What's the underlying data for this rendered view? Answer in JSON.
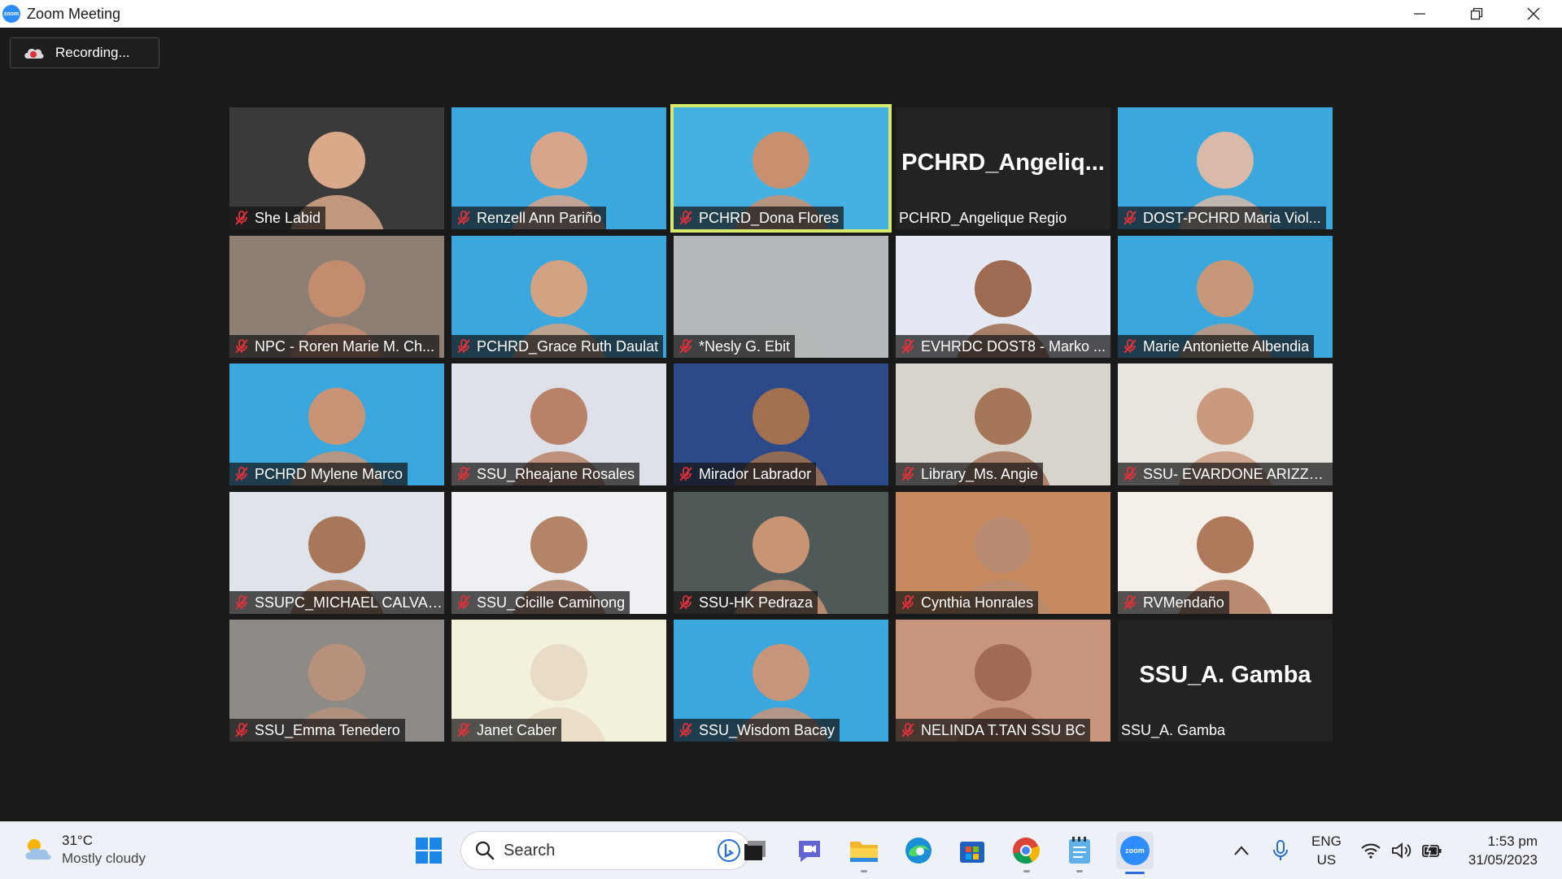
{
  "window": {
    "title": "Zoom Meeting",
    "logo_text": "zoom"
  },
  "recording": {
    "label": "Recording..."
  },
  "participants": [
    {
      "name": "She Labid",
      "bg": "#3a3a3a",
      "skin": "#d9a98a"
    },
    {
      "name": "Renzell Ann Pariño",
      "bg": "#3aa7de",
      "skin": "#d8a58a"
    },
    {
      "name": "PCHRD_Dona Flores",
      "bg": "#45b1e2",
      "skin": "#c9906f",
      "active": true
    },
    {
      "name": "PCHRD_Angelique Regio",
      "big": "PCHRD_Angeliq...",
      "no_video": true
    },
    {
      "name": "DOST-PCHRD Maria Viol...",
      "bg": "#3aa7de",
      "skin": "#d9b9a8"
    },
    {
      "name": "NPC - Roren Marie M. Ch...",
      "bg": "#8d7f74",
      "skin": "#c48c6e"
    },
    {
      "name": "PCHRD_Grace Ruth Daulat",
      "bg": "#3aa7de",
      "skin": "#d3a282"
    },
    {
      "name": "*Nesly G. Ebit",
      "bg": "#b5b8ba",
      "skin": "#b5b8ba"
    },
    {
      "name": "EVHRDC DOST8 - Marko ...",
      "bg": "#e4e9f4",
      "skin": "#9e6b52"
    },
    {
      "name": "Marie Antoniette Albendia",
      "bg": "#3aa7de",
      "skin": "#c7977a"
    },
    {
      "name": "PCHRD Mylene Marco",
      "bg": "#3aa7de",
      "skin": "#c89475"
    },
    {
      "name": "SSU_Rheajane Rosales",
      "bg": "#dfe1ea",
      "skin": "#b88268"
    },
    {
      "name": "Mirador Labrador",
      "bg": "#2c4a8a",
      "skin": "#a3704f"
    },
    {
      "name": "Library_Ms. Angie",
      "bg": "#d8d4cc",
      "skin": "#a67659"
    },
    {
      "name": "SSU- EVARDONE ARIZZA ...",
      "bg": "#e8e4de",
      "skin": "#c99a7e"
    },
    {
      "name": "SSUPC_MICHAEL CALVAD...",
      "bg": "#dfe3ea",
      "skin": "#a87658"
    },
    {
      "name": "SSU_Cicille Caminong",
      "bg": "#eef0f3",
      "skin": "#b38468"
    },
    {
      "name": "SSU-HK Pedraza",
      "bg": "#4f5a58",
      "skin": "#c99474"
    },
    {
      "name": "Cynthia Honrales",
      "bg": "#c78a5e",
      "skin": "#b98b70"
    },
    {
      "name": "RVMendaño",
      "bg": "#f4efe8",
      "skin": "#b0795c"
    },
    {
      "name": "SSU_Emma Tenedero",
      "bg": "#8e8a85",
      "skin": "#b8917c"
    },
    {
      "name": "Janet Caber",
      "bg": "#f4f1da",
      "skin": "#e9dcc7"
    },
    {
      "name": "SSU_Wisdom Bacay",
      "bg": "#3aa7de",
      "skin": "#c8947a"
    },
    {
      "name": "NELINDA T.TAN SSU BC",
      "bg": "#c8947e",
      "skin": "#a06a54"
    },
    {
      "name": "SSU_A. Gamba",
      "big": "SSU_A. Gamba",
      "no_video": true
    }
  ],
  "taskbar": {
    "weather_temp": "31°C",
    "weather_cond": "Mostly cloudy",
    "search_label": "Search",
    "lang_top": "ENG",
    "lang_bottom": "US",
    "time": "1:53 pm",
    "date": "31/05/2023",
    "zoom_label": "zoom"
  }
}
